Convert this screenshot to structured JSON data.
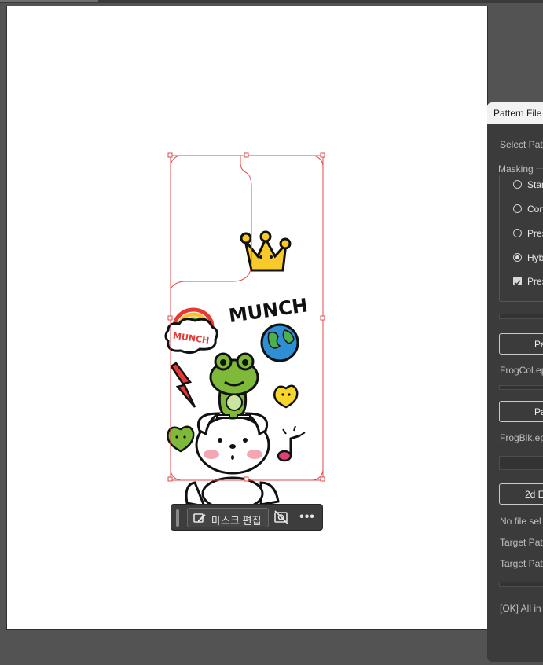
{
  "context_toolbar": {
    "mask_edit_label": "마스크 편집",
    "more_label": "•••"
  },
  "artwork": {
    "munch_title": "MUNCH",
    "cloud_text": "MUNCH"
  },
  "dialog": {
    "title": "Pattern File",
    "select_label": "Select Patt",
    "masking_group": "Masking",
    "options": [
      {
        "label": "Stan",
        "type": "radio",
        "checked": false
      },
      {
        "label": "Con",
        "type": "radio",
        "checked": false
      },
      {
        "label": "Pres",
        "type": "radio",
        "checked": false
      },
      {
        "label": "Hyb",
        "type": "radio",
        "checked": true
      },
      {
        "label": "Pres",
        "type": "checkbox",
        "checked": true
      }
    ],
    "button1": "Pa",
    "file1": "FrogCol.ep",
    "button2": "Pa",
    "file2": "FrogBlk.ep",
    "button3": "2d E",
    "no_file": "No file sel",
    "target1": "Target Pat",
    "target2": "Target Pat",
    "status": "[OK] All in"
  }
}
